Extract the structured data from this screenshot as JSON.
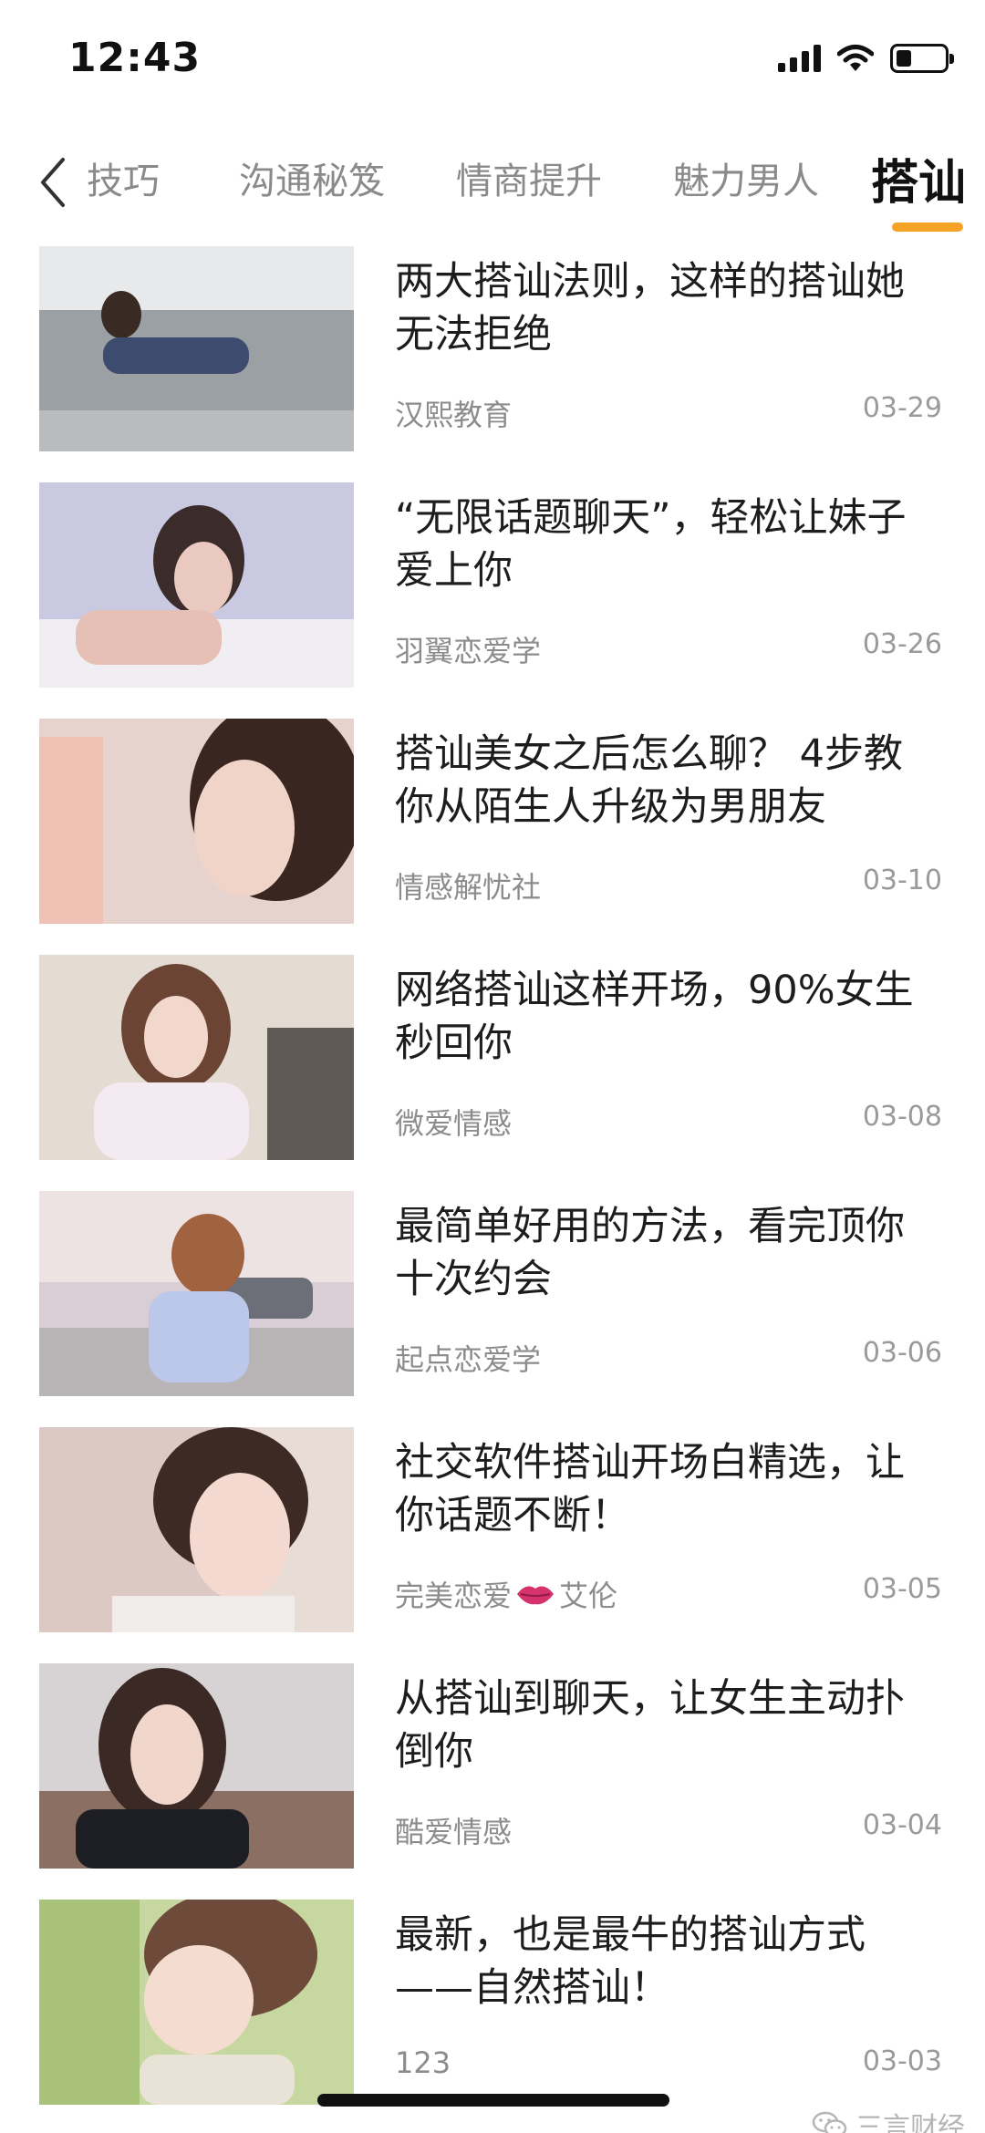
{
  "status_bar": {
    "time": "12:43",
    "battery_level": 0.3
  },
  "tabs": [
    {
      "label": "技巧",
      "active": false
    },
    {
      "label": "沟通秘笈",
      "active": false
    },
    {
      "label": "情商提升",
      "active": false
    },
    {
      "label": "魅力男人",
      "active": false
    },
    {
      "label": "搭讪",
      "active": true
    }
  ],
  "colors": {
    "accent": "#f4a326",
    "title_text": "#1d1d1d",
    "meta_text": "#8c8c8c"
  },
  "articles": [
    {
      "title": "两大搭讪法则，这样的搭讪她无法拒绝",
      "source": "汉熙教育",
      "date": "03-29"
    },
    {
      "title": "“无限话题聊天”，轻松让妹子爱上你",
      "source": "羽翼恋爱学",
      "date": "03-26"
    },
    {
      "title": "搭讪美女之后怎么聊？ 4步教你从陌生人升级为男朋友",
      "source": "情感解忧社",
      "date": "03-10"
    },
    {
      "title": "网络搭讪这样开场，90%女生秒回你",
      "source": "微爱情感",
      "date": "03-08"
    },
    {
      "title": "最简单好用的方法，看完顶你十次约会",
      "source": "起点恋爱学",
      "date": "03-06"
    },
    {
      "title": "社交软件搭讪开场白精选，让你话题不断！",
      "source": "完美恋爱",
      "source_suffix": "艾伦",
      "date": "03-05"
    },
    {
      "title": "从搭讪到聊天，让女生主动扑倒你",
      "source": "酷爱情感",
      "date": "03-04"
    },
    {
      "title": "最新，也是最牛的搭讪方式——自然搭讪！",
      "source": "123",
      "date": "03-03"
    }
  ],
  "watermark": {
    "text": "三言财经"
  }
}
